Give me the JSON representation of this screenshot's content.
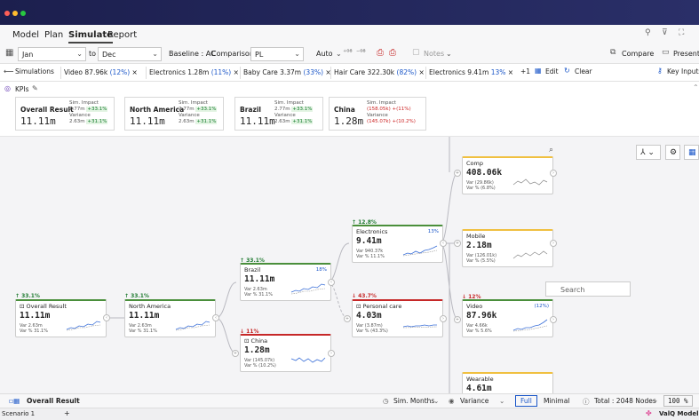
{
  "menu": {
    "items": [
      "Model",
      "Plan",
      "Simulate",
      "Report"
    ]
  },
  "toolbar": {
    "from": "Jan",
    "to_label": "to",
    "to": "Dec",
    "baseline": "Baseline : AC",
    "comparison_label": "Comparison",
    "comparison": "PL",
    "auto": "Auto",
    "notes": "Notes",
    "compare": "Compare",
    "present": "Present"
  },
  "simbar": {
    "label": "Simulations",
    "chips": [
      {
        "name": "Video",
        "value": "87.96k",
        "pct": "(12%)"
      },
      {
        "name": "Electronics",
        "value": "1.28m",
        "pct": "(11%)"
      },
      {
        "name": "Baby Care",
        "value": "3.37m",
        "pct": "(33%)"
      },
      {
        "name": "Hair Care",
        "value": "322.30k",
        "pct": "(82%)"
      },
      {
        "name": "Electronics",
        "value": "9.41m",
        "pct": "13%"
      }
    ],
    "more": "+1",
    "edit": "Edit",
    "clear": "Clear",
    "key_inputs": "Key Inputs"
  },
  "kpis": {
    "title": "KPIs",
    "cards": [
      {
        "name": "Overall Result",
        "value": "11.11m",
        "imp": "2.77m",
        "imp_pct": "+33.1%",
        "var": "2.63m",
        "var_pct": "+31.1%"
      },
      {
        "name": "North America",
        "value": "11.11m",
        "imp": "2.77m",
        "imp_pct": "+33.1%",
        "var": "2.63m",
        "var_pct": "+31.1%"
      },
      {
        "name": "Brazil",
        "value": "11.11m",
        "imp": "2.77m",
        "imp_pct": "+33.1%",
        "var": "2.63m",
        "var_pct": "+31.1%"
      },
      {
        "name": "China",
        "value": "1.28m",
        "imp": "(158.05k)",
        "imp_pct": "+(11%)",
        "var": "(145.07k)",
        "var_pct": "+(10.2%)"
      }
    ],
    "sim_impact": "Sim. Impact",
    "variance": "Variance"
  },
  "nodes": {
    "overall": {
      "impact": "33.1%",
      "name": "Overall Result",
      "value": "11.11m",
      "var": "2.63m",
      "varp": "31.1%"
    },
    "na": {
      "impact": "33.1%",
      "name": "North America",
      "value": "11.11m",
      "var": "2.63m",
      "varp": "31.1%"
    },
    "brazil": {
      "impact": "33.1%",
      "name": "Brazil",
      "value": "11.11m",
      "var": "2.63m",
      "varp": "31.1%",
      "badge": "18%"
    },
    "china": {
      "impact": "11%",
      "name": "China",
      "value": "1.28m",
      "var": "(145.07k)",
      "varp": "(10.2%)"
    },
    "electronics": {
      "impact": "12.8%",
      "name": "Electronics",
      "value": "9.41m",
      "var": "940.37k",
      "varp": "11.1%",
      "badge": "13%"
    },
    "personal": {
      "impact": "43.7%",
      "name": "Personal care",
      "value": "4.03m",
      "var": "(3.87m)",
      "varp": "(43.3%)"
    },
    "comp": {
      "name": "Comp",
      "value": "408.06k",
      "var": "(29.86k)",
      "varp": "(6.8%)"
    },
    "mobile": {
      "name": "Mobile",
      "value": "2.18m",
      "var": "(126.01k)",
      "varp": "(5.5%)"
    },
    "video": {
      "impact": "12%",
      "name": "Video",
      "value": "87.96k",
      "var": "4.66k",
      "varp": "5.6%",
      "badge": "(12%)"
    },
    "wearable": {
      "name": "Wearable",
      "value": "4.61m"
    }
  },
  "var_label": "Var",
  "varp_label": "Var %",
  "search": {
    "placeholder": "Search"
  },
  "status": {
    "tab": "Overall Result",
    "months": "Sim. Months",
    "variance": "Variance",
    "full": "Full",
    "minimal": "Minimal",
    "total": "Total : 2048 Nodes",
    "zoom": "100 %"
  },
  "scenario": {
    "name": "Scenario 1",
    "add": "+",
    "brand": "ValQ Model"
  },
  "colors": {
    "accent": "#1a56c8",
    "positive": "#1e7a30",
    "negative": "#c62828"
  }
}
